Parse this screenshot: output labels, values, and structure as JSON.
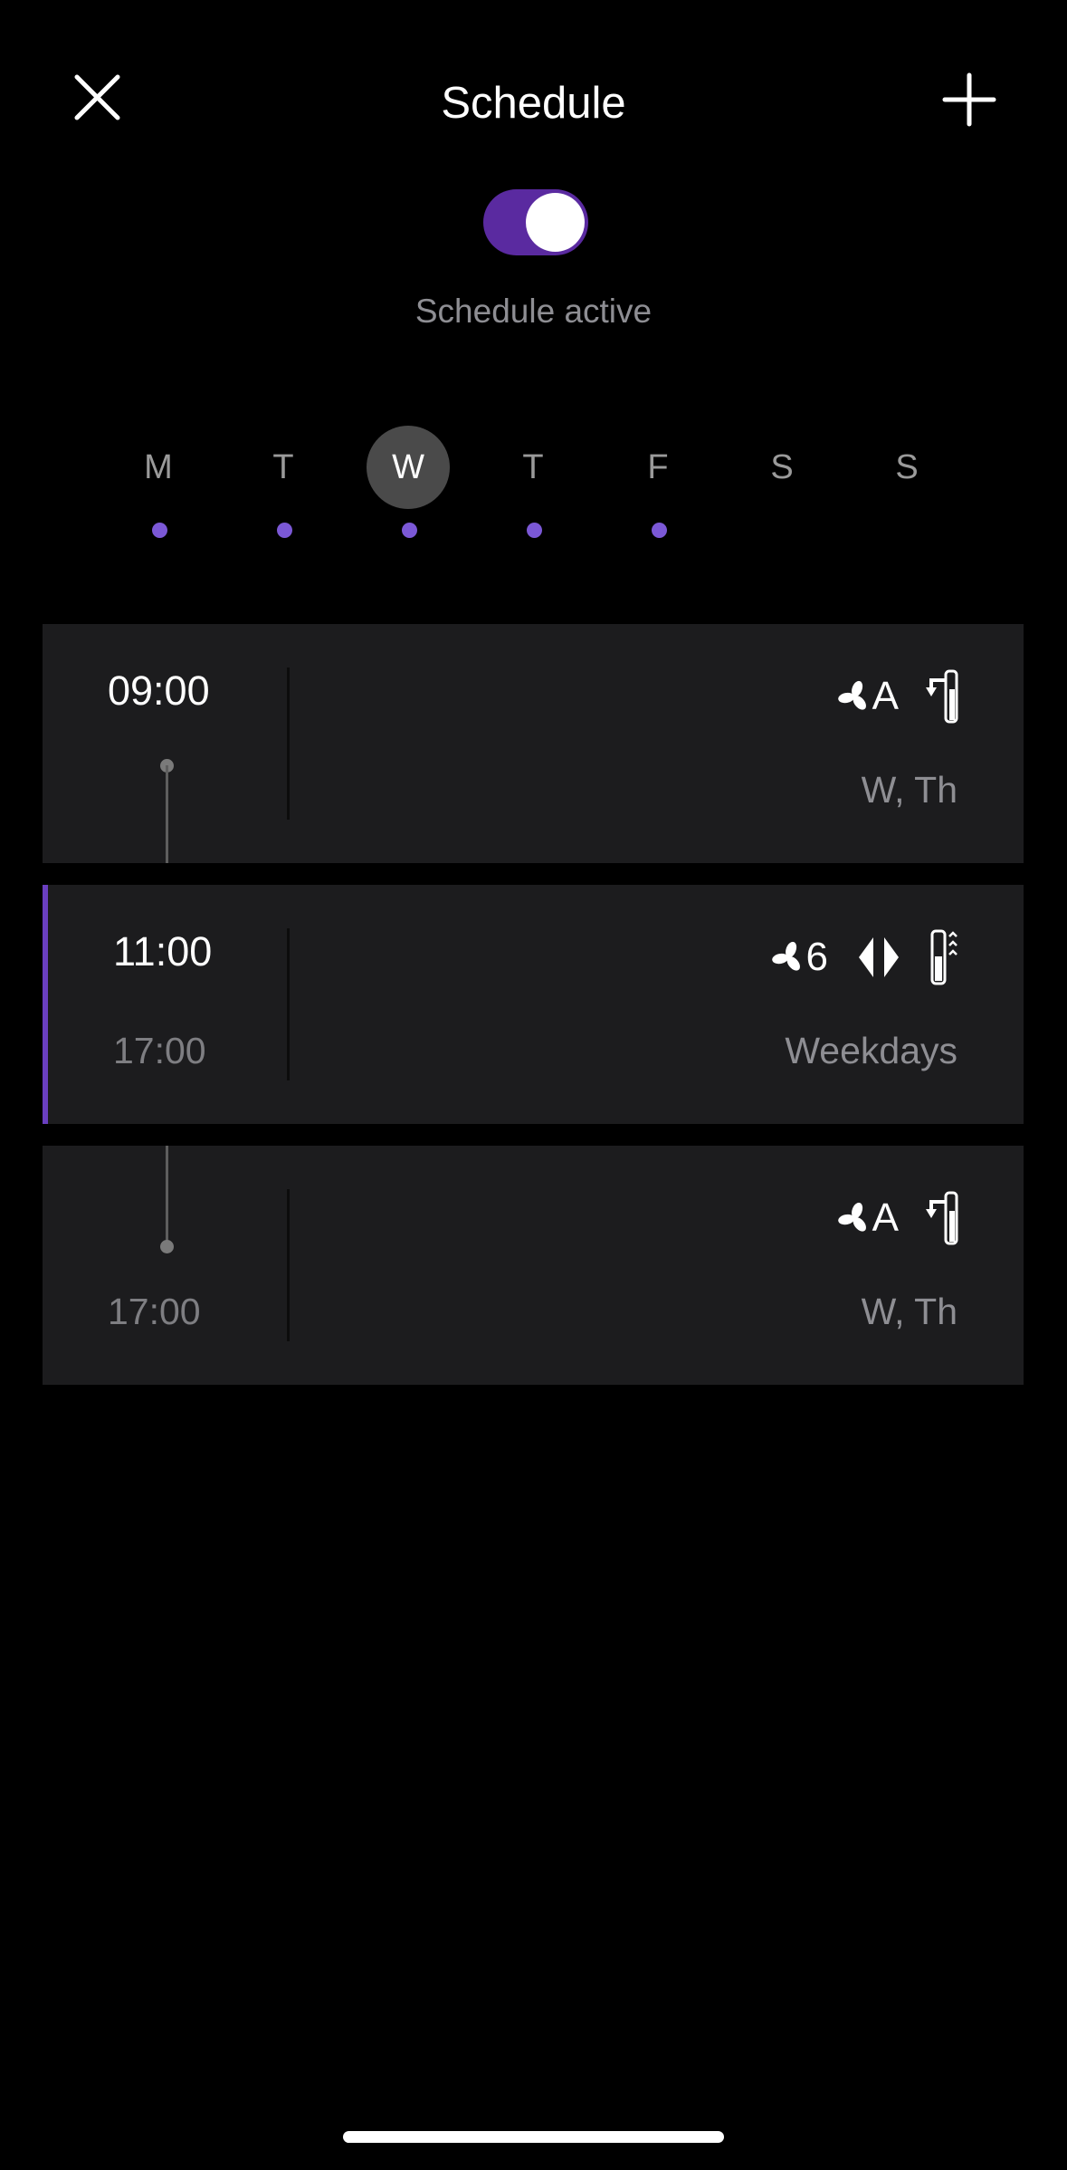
{
  "header": {
    "title": "Schedule",
    "close_icon": "close-icon",
    "add_icon": "plus-icon"
  },
  "schedule_toggle": {
    "on": true,
    "caption": "Schedule active"
  },
  "days": [
    {
      "label": "M",
      "has_schedule": true,
      "selected": false
    },
    {
      "label": "T",
      "has_schedule": true,
      "selected": false
    },
    {
      "label": "W",
      "has_schedule": true,
      "selected": true
    },
    {
      "label": "T",
      "has_schedule": true,
      "selected": false
    },
    {
      "label": "F",
      "has_schedule": true,
      "selected": false
    },
    {
      "label": "S",
      "has_schedule": false,
      "selected": false
    },
    {
      "label": "S",
      "has_schedule": false,
      "selected": false
    }
  ],
  "entries": [
    {
      "start": "09:00",
      "end": "",
      "fan_speed": "A",
      "days": "W, Th",
      "icons": [
        "fan-icon",
        "airflow-direction-icon"
      ],
      "active": false
    },
    {
      "start": "11:00",
      "end": "17:00",
      "fan_speed": "6",
      "days": "Weekdays",
      "icons": [
        "fan-icon",
        "oscillation-icon",
        "heat-mode-icon"
      ],
      "active": true
    },
    {
      "start": "",
      "end": "17:00",
      "fan_speed": "A",
      "days": "W, Th",
      "icons": [
        "fan-icon",
        "airflow-direction-icon"
      ],
      "active": false
    }
  ],
  "colors": {
    "background": "#000000",
    "card": "#1c1c1e",
    "accent": "#5a2aa0",
    "dot": "#7b58d6",
    "muted_text": "#8e8e93"
  }
}
